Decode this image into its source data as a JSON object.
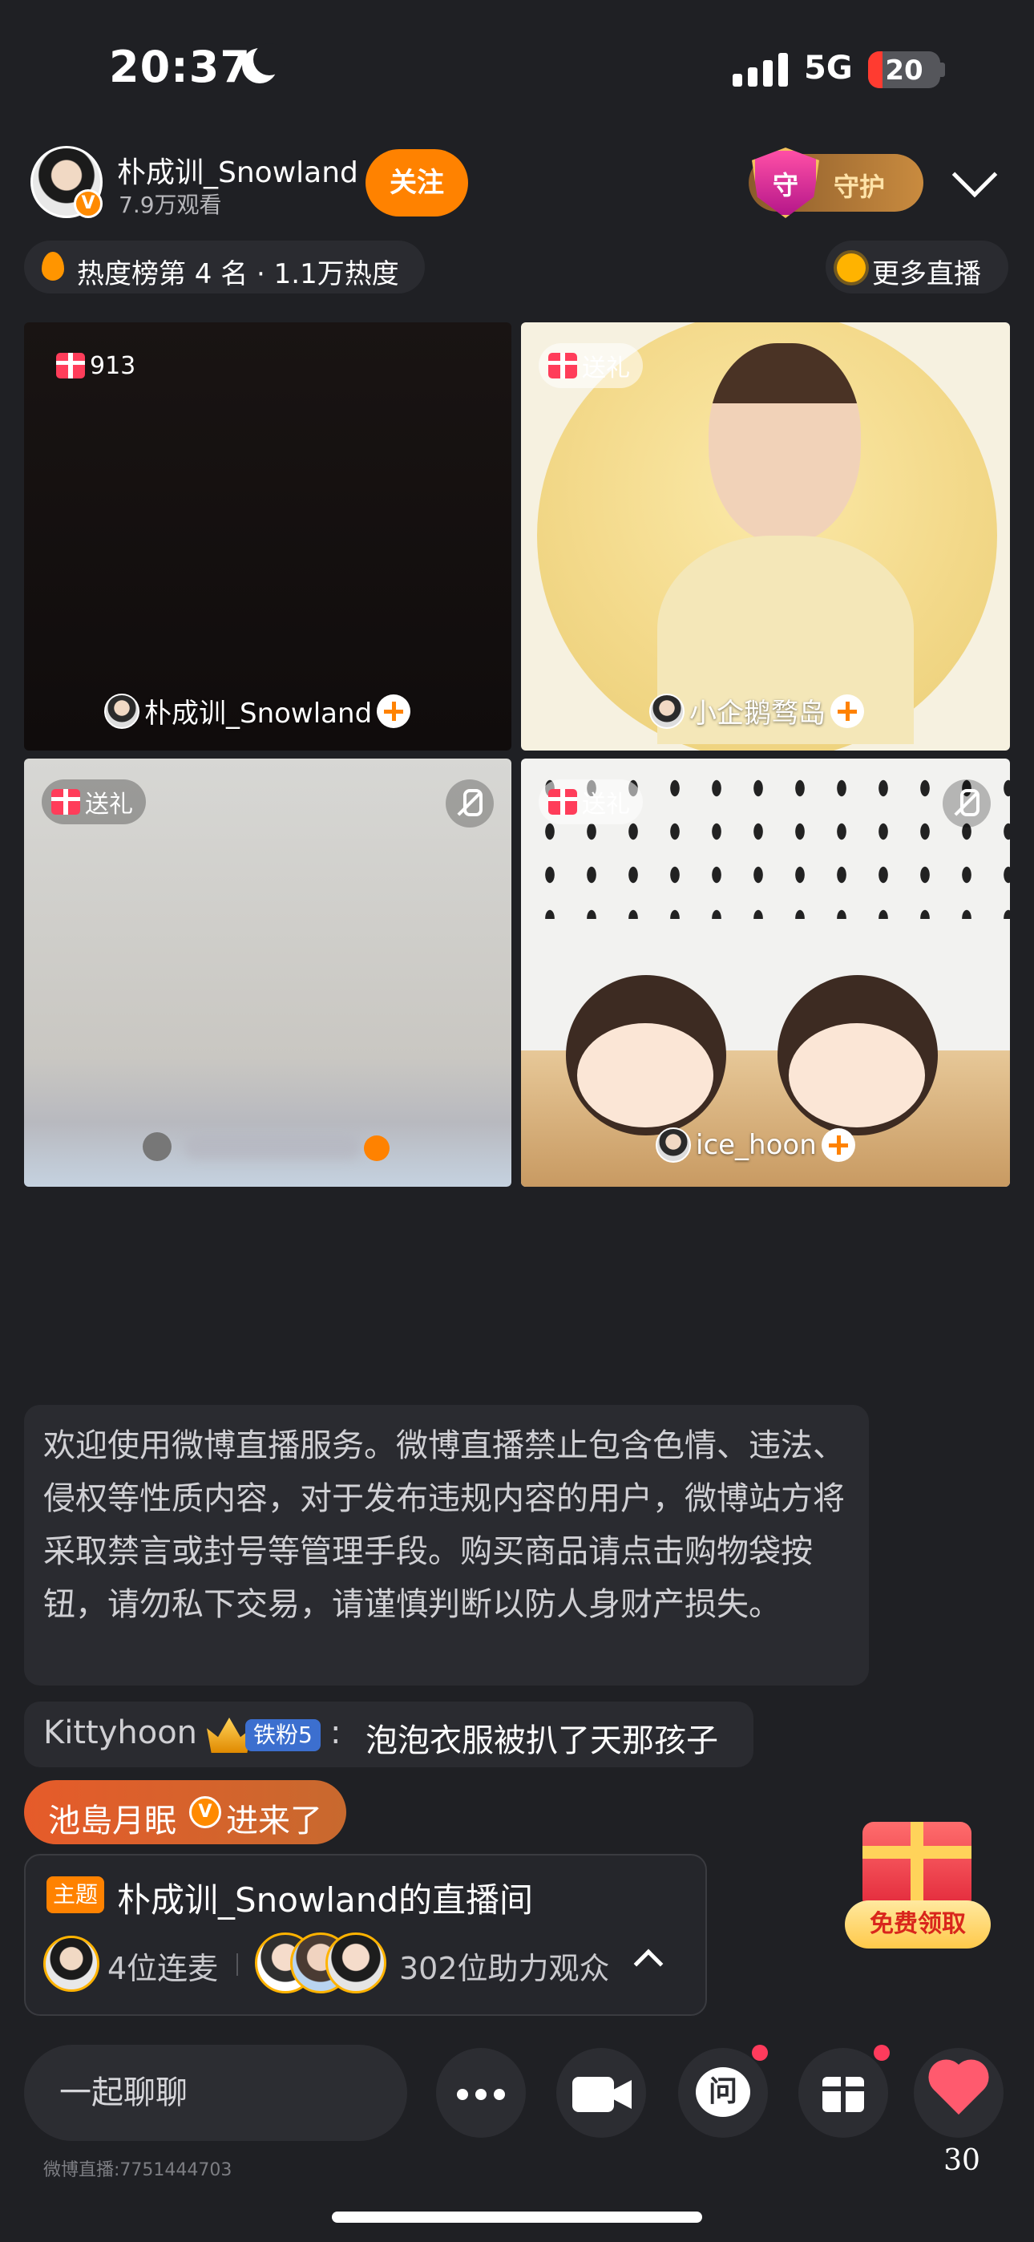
{
  "status_bar": {
    "time": "20:37",
    "network": "5G",
    "battery": "20"
  },
  "header": {
    "host_name": "朴成训_Snowland",
    "views": "7.9万观看",
    "follow_label": "关注",
    "guard_label": "守护",
    "guard_shield": "守",
    "verify_mark": "V",
    "hot_rank": "热度榜第 4 名 · 1.1万热度",
    "more_live": "更多直播"
  },
  "tiles": [
    {
      "badge": "913",
      "name": "朴成训_Snowland"
    },
    {
      "badge": "送礼",
      "name": "小企鹅骛岛"
    },
    {
      "badge": "送礼"
    },
    {
      "badge": "送礼",
      "name": "ice_hoon"
    }
  ],
  "chat": {
    "notice": "欢迎使用微博直播服务。微博直播禁止包含色情、违法、侵权等性质内容，对于发布违规内容的用户，微博站方将采取禁言或封号等管理手段。购买商品请点击购物袋按钮，请勿私下交易，请谨慎判断以防人身财产损失。",
    "message": {
      "user": "Kittyhoon",
      "badge": "铁粉5",
      "colon": ":",
      "text": "泡泡衣服被扒了天那孩子"
    },
    "enter": {
      "name": "池島月眠",
      "verify_mark": "V",
      "text": "进来了"
    }
  },
  "room": {
    "tag": "主题",
    "title": "朴成训_Snowland的直播间",
    "linked": "4位连麦",
    "audience": "302位助力观众"
  },
  "free_gift_label": "免费领取",
  "bottom": {
    "input_placeholder": "一起聊聊",
    "ask_label": "问",
    "like_count": "30",
    "footer_id": "微博直播:7751444703"
  },
  "colors": {
    "accent": "#ff8200",
    "background": "#1f2024",
    "panel": "#2a2b30"
  }
}
